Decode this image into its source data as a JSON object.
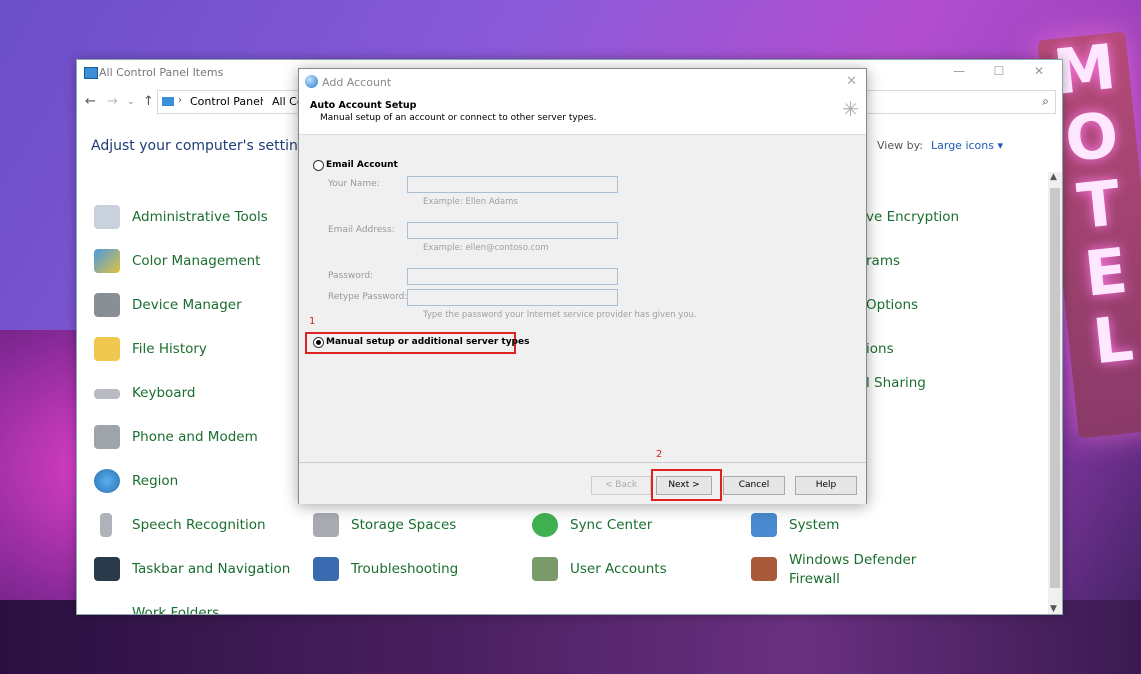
{
  "control_panel": {
    "window_title": "All Control Panel Items",
    "address": {
      "crumb1": "Control Panel",
      "crumb2": "All Co"
    },
    "heading": "Adjust your computer's settings",
    "view_by": {
      "label": "View by:",
      "value": "Large icons ▾"
    },
    "items_col1": [
      "Administrative Tools",
      "Color Management",
      "Device Manager",
      "File History",
      "Keyboard",
      "Phone and Modem",
      "Region",
      "Speech Recognition",
      "Taskbar and Navigation",
      "Work Folders"
    ],
    "items_col2": [
      "Storage Spaces",
      "Troubleshooting"
    ],
    "items_col3": [
      "Sync Center",
      "User Accounts"
    ],
    "items_col4": [
      "System",
      "Windows Defender Firewall"
    ],
    "items_right_partial": [
      "ve Encryption",
      "rams",
      "Options",
      "ions",
      "l Sharing"
    ]
  },
  "dialog": {
    "title": "Add Account",
    "header_title": "Auto Account Setup",
    "header_subtitle": "Manual setup of an account or connect to other server types.",
    "email_account_label": "Email Account",
    "your_name_label": "Your Name:",
    "your_name_hint": "Example: Ellen Adams",
    "email_address_label": "Email Address:",
    "email_address_hint": "Example: ellen@contoso.com",
    "password_label": "Password:",
    "retype_password_label": "Retype Password:",
    "password_hint": "Type the password your Internet service provider has given you.",
    "manual_setup_label": "Manual setup or additional server types",
    "annotation_1": "1",
    "annotation_2": "2",
    "buttons": {
      "back": "< Back",
      "next": "Next >",
      "cancel": "Cancel",
      "help": "Help"
    }
  },
  "background": {
    "sign_text": [
      "M",
      "O",
      "T",
      "E",
      "L"
    ]
  }
}
